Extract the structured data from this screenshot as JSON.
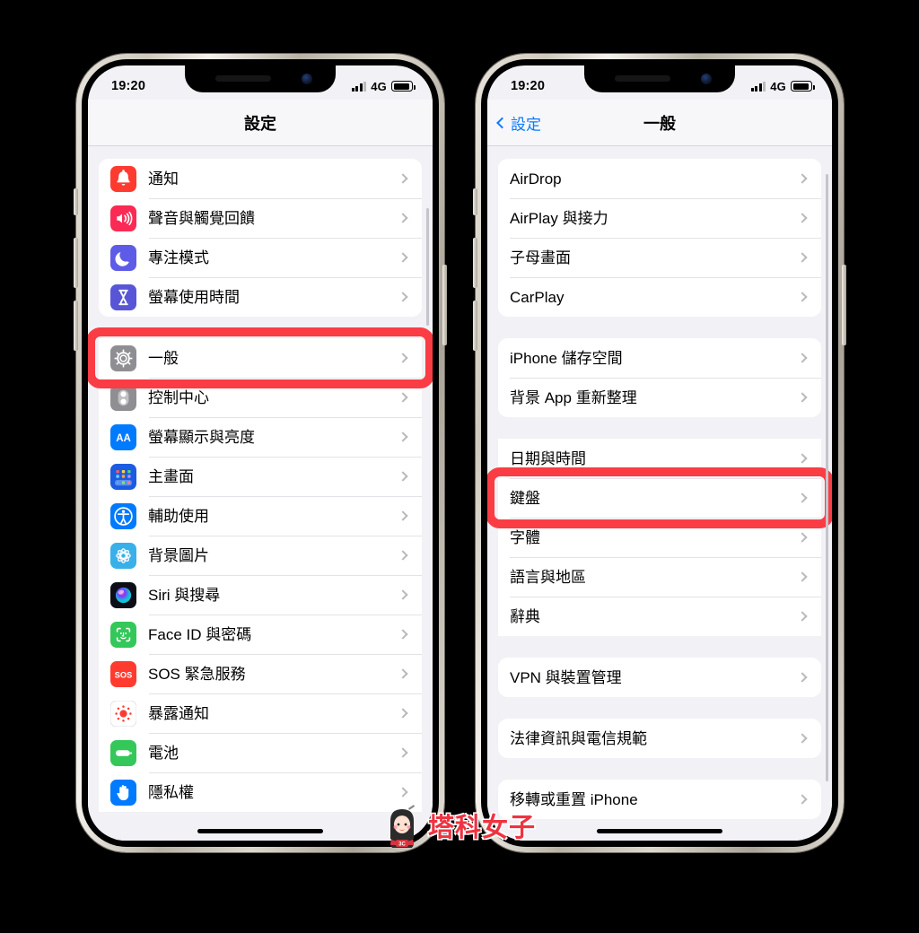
{
  "status_bar": {
    "time": "19:20",
    "network": "4G",
    "signal_bars": 4,
    "battery_level": "full"
  },
  "watermark": {
    "text": "塔科女子",
    "badge": "3C"
  },
  "colors": {
    "highlight_red": "#fa3c44",
    "ios_blue": "#0a7cff",
    "screen_bg": "#f2f1f6",
    "row_bg": "#ffffff",
    "separator": "#e3e2e6",
    "chevron_gray": "#b8b8bd"
  },
  "left_phone": {
    "nav": {
      "title": "設定",
      "back_label": ""
    },
    "groups": [
      {
        "rows": [
          {
            "label": "通知",
            "icon": "notification-bell-icon",
            "icon_color": "#ff3b30",
            "highlighted": false
          },
          {
            "label": "聲音與觸覺回饋",
            "icon": "sound-speaker-icon",
            "icon_color": "#fa2a55",
            "highlighted": false
          },
          {
            "label": "專注模式",
            "icon": "focus-moon-icon",
            "icon_color": "#5e5ce6",
            "highlighted": false
          },
          {
            "label": "螢幕使用時間",
            "icon": "screentime-hourglass-icon",
            "icon_color": "#5856d6",
            "highlighted": false
          }
        ]
      },
      {
        "rows": [
          {
            "label": "一般",
            "icon": "general-gear-icon",
            "icon_color": "#8e8e93",
            "highlighted": true
          },
          {
            "label": "控制中心",
            "icon": "control-center-toggles-icon",
            "icon_color": "#8e8e93",
            "highlighted": false
          },
          {
            "label": "螢幕顯示與亮度",
            "icon": "display-brightness-aa-icon",
            "icon_color": "#007aff",
            "highlighted": false
          },
          {
            "label": "主畫面",
            "icon": "home-screen-grid-icon",
            "icon_color": "#1b5ce0",
            "highlighted": false
          },
          {
            "label": "輔助使用",
            "icon": "accessibility-person-icon",
            "icon_color": "#007aff",
            "highlighted": false
          },
          {
            "label": "背景圖片",
            "icon": "wallpaper-flower-icon",
            "icon_color": "#3ab0e8",
            "highlighted": false
          },
          {
            "label": "Siri 與搜尋",
            "icon": "siri-orb-icon",
            "icon_color": "#2b1f3a",
            "highlighted": false
          },
          {
            "label": "Face ID 與密碼",
            "icon": "faceid-face-icon",
            "icon_color": "#34c759",
            "highlighted": false
          },
          {
            "label": "SOS 緊急服務",
            "icon": "sos-emergency-icon",
            "icon_color": "#ff3b30",
            "highlighted": false
          },
          {
            "label": "暴露通知",
            "icon": "exposure-notification-icon",
            "icon_color": "#ffffff",
            "highlighted": false
          },
          {
            "label": "電池",
            "icon": "battery-icon",
            "icon_color": "#34c759",
            "highlighted": false
          },
          {
            "label": "隱私權",
            "icon": "privacy-hand-icon",
            "icon_color": "#007aff",
            "highlighted": false
          }
        ]
      }
    ],
    "scrollbar": {
      "top_pct": 9,
      "height_pct": 17
    }
  },
  "right_phone": {
    "nav": {
      "title": "一般",
      "back_label": "設定"
    },
    "groups": [
      {
        "rows": [
          {
            "label": "AirDrop",
            "highlighted": false
          },
          {
            "label": "AirPlay 與接力",
            "highlighted": false
          },
          {
            "label": "子母畫面",
            "highlighted": false
          },
          {
            "label": "CarPlay",
            "highlighted": false
          }
        ]
      },
      {
        "rows": [
          {
            "label": "iPhone 儲存空間",
            "highlighted": false
          },
          {
            "label": "背景 App 重新整理",
            "highlighted": false
          }
        ]
      },
      {
        "rows": [
          {
            "label": "日期與時間",
            "highlighted": false
          },
          {
            "label": "鍵盤",
            "highlighted": true
          },
          {
            "label": "字體",
            "highlighted": false
          },
          {
            "label": "語言與地區",
            "highlighted": false
          },
          {
            "label": "辭典",
            "highlighted": false
          }
        ]
      },
      {
        "rows": [
          {
            "label": "VPN 與裝置管理",
            "highlighted": false
          }
        ]
      },
      {
        "rows": [
          {
            "label": "法律資訊與電信規範",
            "highlighted": false
          }
        ]
      },
      {
        "rows": [
          {
            "label": "移轉或重置 iPhone",
            "highlighted": false
          }
        ]
      }
    ],
    "scrollbar": {
      "top_pct": 4,
      "height_pct": 88
    }
  }
}
